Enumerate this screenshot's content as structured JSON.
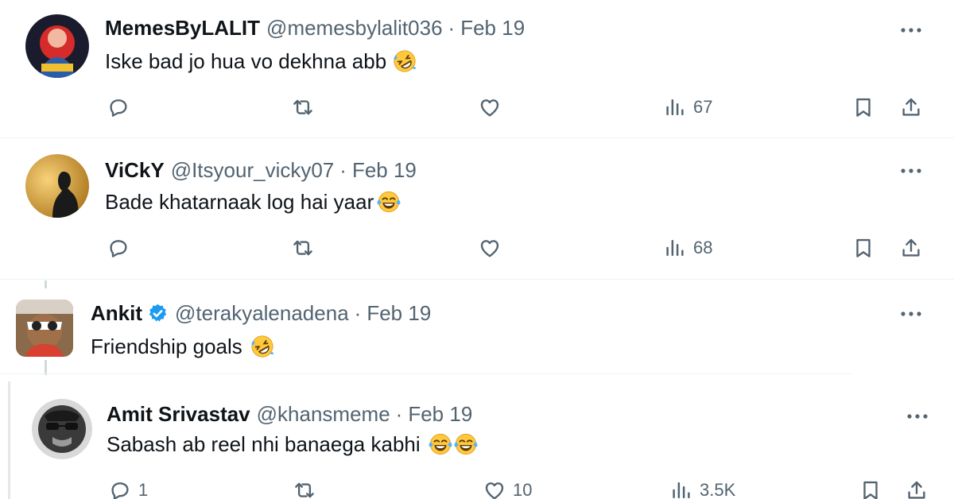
{
  "tweets": [
    {
      "name": "MemesByLALIT",
      "handle": "@memesbylalit036",
      "separator": "·",
      "date": "Feb 19",
      "text": "Iske bad jo hua vo dekhna abb",
      "emoji": "rolling-on-floor-laughing",
      "verified": false,
      "replies": "",
      "reposts": "",
      "likes": "",
      "views": "67"
    },
    {
      "name": "ViCkY",
      "handle": "@Itsyour_vicky07",
      "separator": "·",
      "date": "Feb 19",
      "text": "Bade khatarnaak log hai yaar",
      "emoji": "face-with-tears-of-joy",
      "verified": false,
      "replies": "",
      "reposts": "",
      "likes": "",
      "views": "68"
    },
    {
      "name": "Ankit",
      "handle": "@terakyalenadena",
      "separator": "·",
      "date": "Feb 19",
      "text": "Friendship goals",
      "emoji": "rolling-on-floor-laughing",
      "verified": true,
      "verified_color": "#1d9bf0"
    },
    {
      "name": "Amit Srivastav",
      "handle": "@khansmeme",
      "separator": "·",
      "date": "Feb 19",
      "text": "Sabash ab reel nhi banaega kabhi",
      "emoji": "face-with-tears-of-joy x2",
      "verified": false,
      "replies": "1",
      "reposts": "",
      "likes": "10",
      "views": "3.5K"
    }
  ],
  "colors": {
    "text_primary": "#0f1419",
    "text_secondary": "#536471",
    "verified": "#1d9bf0",
    "border": "#eff3f4"
  }
}
